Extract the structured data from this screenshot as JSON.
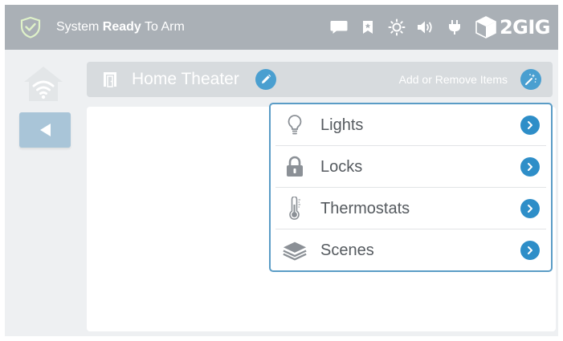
{
  "status_bar": {
    "status_prefix": "System ",
    "status_bold": "Ready",
    "status_suffix": " To Arm",
    "shield_color": "#e6f4d6",
    "icons": [
      "message-icon",
      "bookmark-icon",
      "brightness-icon",
      "volume-icon",
      "plug-icon"
    ],
    "brand": "2GIG"
  },
  "room": {
    "name": "Home Theater",
    "add_remove_label": "Add or Remove Items"
  },
  "menu": {
    "items": [
      {
        "label": "Lights",
        "icon": "lightbulb-icon"
      },
      {
        "label": "Locks",
        "icon": "lock-icon"
      },
      {
        "label": "Thermostats",
        "icon": "thermometer-icon"
      },
      {
        "label": "Scenes",
        "icon": "layers-icon"
      }
    ]
  },
  "colors": {
    "accent": "#2e8ec8",
    "menu_border": "#5a9cc6",
    "topbar": "#aab0b6",
    "back_button": "#a9c5d8"
  }
}
